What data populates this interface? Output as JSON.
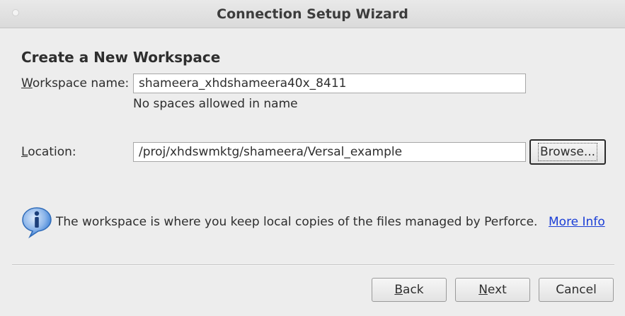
{
  "window": {
    "title": "Connection Setup Wizard"
  },
  "page": {
    "heading": "Create a New Workspace"
  },
  "workspace": {
    "label_mnemonic": "W",
    "label_rest": "orkspace name:",
    "value": "shameera_xhdshameera40x_8411",
    "hint": "No spaces allowed in name"
  },
  "location": {
    "label_mnemonic": "L",
    "label_rest": "ocation:",
    "value": "/proj/xhdswmktg/shameera/Versal_example",
    "browse_label": "Browse..."
  },
  "info": {
    "icon": "info-icon",
    "text": "The workspace is where you keep local copies of the files managed by Perforce.",
    "link_label": "More Info"
  },
  "buttons": {
    "back_mnemonic": "B",
    "back_rest": "ack",
    "next_mnemonic": "N",
    "next_rest": "ext",
    "cancel_label": "Cancel"
  },
  "colors": {
    "background": "#ededed",
    "link": "#1a3ed6",
    "info_icon_fill": "#3b7fd4"
  }
}
